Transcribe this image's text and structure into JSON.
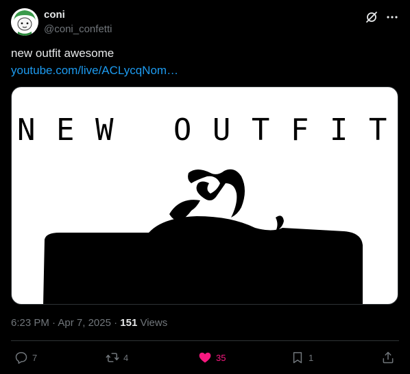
{
  "author": {
    "display_name": "coni",
    "handle": "@coni_confetti"
  },
  "tweet": {
    "text": "new outfit awesome",
    "link_text": "youtube.com/live/ACLycqNom…"
  },
  "media": {
    "title_text": "N E W   O U T F I T"
  },
  "meta": {
    "time": "6:23 PM",
    "sep1": " · ",
    "date": "Apr 7, 2025",
    "sep2": " · ",
    "views_count": "151",
    "views_label": " Views"
  },
  "actions": {
    "reply_count": "7",
    "repost_count": "4",
    "like_count": "35",
    "bookmark_count": "1"
  },
  "icons": {
    "grok": "grok-slash-circle-icon",
    "more": "more-dots-icon",
    "reply": "reply-bubble-icon",
    "repost": "repost-arrows-icon",
    "like": "heart-icon",
    "bookmark": "bookmark-icon",
    "share": "share-upload-icon"
  },
  "colors": {
    "background": "#000000",
    "text": "#e7e9ea",
    "secondary": "#71767b",
    "link": "#1d9bf0",
    "like": "#f91880",
    "divider": "#2f3336"
  }
}
